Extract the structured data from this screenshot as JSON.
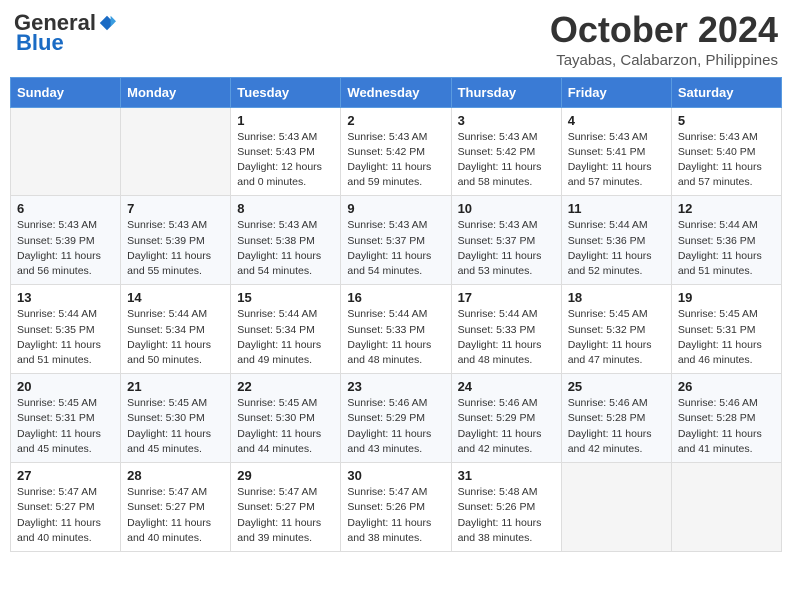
{
  "header": {
    "logo_general": "General",
    "logo_blue": "Blue",
    "month": "October 2024",
    "location": "Tayabas, Calabarzon, Philippines"
  },
  "days_of_week": [
    "Sunday",
    "Monday",
    "Tuesday",
    "Wednesday",
    "Thursday",
    "Friday",
    "Saturday"
  ],
  "weeks": [
    [
      {
        "day": "",
        "content": ""
      },
      {
        "day": "",
        "content": ""
      },
      {
        "day": "1",
        "content": "Sunrise: 5:43 AM\nSunset: 5:43 PM\nDaylight: 12 hours\nand 0 minutes."
      },
      {
        "day": "2",
        "content": "Sunrise: 5:43 AM\nSunset: 5:42 PM\nDaylight: 11 hours\nand 59 minutes."
      },
      {
        "day": "3",
        "content": "Sunrise: 5:43 AM\nSunset: 5:42 PM\nDaylight: 11 hours\nand 58 minutes."
      },
      {
        "day": "4",
        "content": "Sunrise: 5:43 AM\nSunset: 5:41 PM\nDaylight: 11 hours\nand 57 minutes."
      },
      {
        "day": "5",
        "content": "Sunrise: 5:43 AM\nSunset: 5:40 PM\nDaylight: 11 hours\nand 57 minutes."
      }
    ],
    [
      {
        "day": "6",
        "content": "Sunrise: 5:43 AM\nSunset: 5:39 PM\nDaylight: 11 hours\nand 56 minutes."
      },
      {
        "day": "7",
        "content": "Sunrise: 5:43 AM\nSunset: 5:39 PM\nDaylight: 11 hours\nand 55 minutes."
      },
      {
        "day": "8",
        "content": "Sunrise: 5:43 AM\nSunset: 5:38 PM\nDaylight: 11 hours\nand 54 minutes."
      },
      {
        "day": "9",
        "content": "Sunrise: 5:43 AM\nSunset: 5:37 PM\nDaylight: 11 hours\nand 54 minutes."
      },
      {
        "day": "10",
        "content": "Sunrise: 5:43 AM\nSunset: 5:37 PM\nDaylight: 11 hours\nand 53 minutes."
      },
      {
        "day": "11",
        "content": "Sunrise: 5:44 AM\nSunset: 5:36 PM\nDaylight: 11 hours\nand 52 minutes."
      },
      {
        "day": "12",
        "content": "Sunrise: 5:44 AM\nSunset: 5:36 PM\nDaylight: 11 hours\nand 51 minutes."
      }
    ],
    [
      {
        "day": "13",
        "content": "Sunrise: 5:44 AM\nSunset: 5:35 PM\nDaylight: 11 hours\nand 51 minutes."
      },
      {
        "day": "14",
        "content": "Sunrise: 5:44 AM\nSunset: 5:34 PM\nDaylight: 11 hours\nand 50 minutes."
      },
      {
        "day": "15",
        "content": "Sunrise: 5:44 AM\nSunset: 5:34 PM\nDaylight: 11 hours\nand 49 minutes."
      },
      {
        "day": "16",
        "content": "Sunrise: 5:44 AM\nSunset: 5:33 PM\nDaylight: 11 hours\nand 48 minutes."
      },
      {
        "day": "17",
        "content": "Sunrise: 5:44 AM\nSunset: 5:33 PM\nDaylight: 11 hours\nand 48 minutes."
      },
      {
        "day": "18",
        "content": "Sunrise: 5:45 AM\nSunset: 5:32 PM\nDaylight: 11 hours\nand 47 minutes."
      },
      {
        "day": "19",
        "content": "Sunrise: 5:45 AM\nSunset: 5:31 PM\nDaylight: 11 hours\nand 46 minutes."
      }
    ],
    [
      {
        "day": "20",
        "content": "Sunrise: 5:45 AM\nSunset: 5:31 PM\nDaylight: 11 hours\nand 45 minutes."
      },
      {
        "day": "21",
        "content": "Sunrise: 5:45 AM\nSunset: 5:30 PM\nDaylight: 11 hours\nand 45 minutes."
      },
      {
        "day": "22",
        "content": "Sunrise: 5:45 AM\nSunset: 5:30 PM\nDaylight: 11 hours\nand 44 minutes."
      },
      {
        "day": "23",
        "content": "Sunrise: 5:46 AM\nSunset: 5:29 PM\nDaylight: 11 hours\nand 43 minutes."
      },
      {
        "day": "24",
        "content": "Sunrise: 5:46 AM\nSunset: 5:29 PM\nDaylight: 11 hours\nand 42 minutes."
      },
      {
        "day": "25",
        "content": "Sunrise: 5:46 AM\nSunset: 5:28 PM\nDaylight: 11 hours\nand 42 minutes."
      },
      {
        "day": "26",
        "content": "Sunrise: 5:46 AM\nSunset: 5:28 PM\nDaylight: 11 hours\nand 41 minutes."
      }
    ],
    [
      {
        "day": "27",
        "content": "Sunrise: 5:47 AM\nSunset: 5:27 PM\nDaylight: 11 hours\nand 40 minutes."
      },
      {
        "day": "28",
        "content": "Sunrise: 5:47 AM\nSunset: 5:27 PM\nDaylight: 11 hours\nand 40 minutes."
      },
      {
        "day": "29",
        "content": "Sunrise: 5:47 AM\nSunset: 5:27 PM\nDaylight: 11 hours\nand 39 minutes."
      },
      {
        "day": "30",
        "content": "Sunrise: 5:47 AM\nSunset: 5:26 PM\nDaylight: 11 hours\nand 38 minutes."
      },
      {
        "day": "31",
        "content": "Sunrise: 5:48 AM\nSunset: 5:26 PM\nDaylight: 11 hours\nand 38 minutes."
      },
      {
        "day": "",
        "content": ""
      },
      {
        "day": "",
        "content": ""
      }
    ]
  ]
}
